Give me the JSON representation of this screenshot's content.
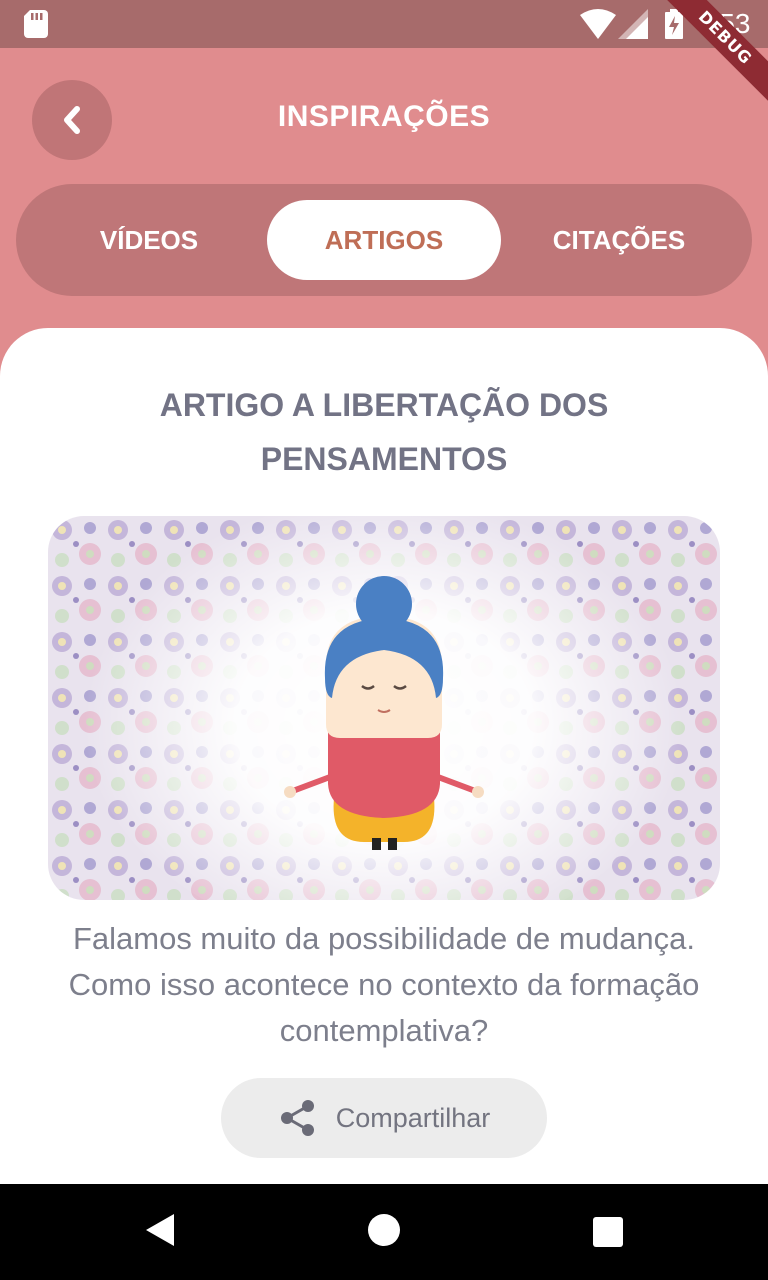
{
  "status_bar": {
    "time": "9:53",
    "icons": [
      "sd-card-icon",
      "wifi-icon",
      "signal-icon",
      "battery-charging-icon"
    ]
  },
  "debug_banner": "DEBUG",
  "header": {
    "title": "INSPIRAÇÕES",
    "back_icon": "chevron-left-icon"
  },
  "tabs": [
    {
      "label": "VÍDEOS",
      "active": false
    },
    {
      "label": "ARTIGOS",
      "active": true
    },
    {
      "label": "CITAÇÕES",
      "active": false
    }
  ],
  "article": {
    "title": "ARTIGO A LIBERTAÇÃO DOS PENSAMENTOS",
    "image_icon": "meditating-figure-illustration",
    "description": "Falamos muito da possibilidade de mudança. Como isso acontece no contexto da formação contemplativa?",
    "share_label": "Compartilhar",
    "share_icon": "share-icon"
  },
  "nav_bar": {
    "icons": [
      "back-triangle-icon",
      "home-circle-icon",
      "recents-square-icon"
    ]
  },
  "colors": {
    "header_bg": "#e08c8e",
    "tab_bar_bg": "#bf7678",
    "active_tab_text": "#bf6e56",
    "status_bar_bg": "#a76b6b",
    "title_text": "#727385"
  }
}
